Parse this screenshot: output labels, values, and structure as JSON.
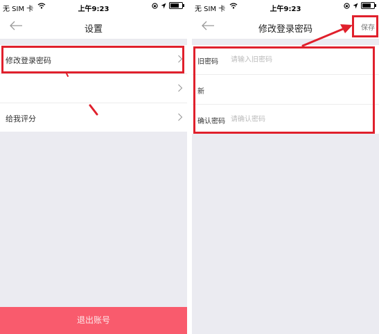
{
  "status_bar": {
    "carrier": "无 SIM 卡",
    "time": "上午9:23"
  },
  "settings_screen": {
    "title": "设置",
    "items": [
      {
        "label": "修改登录密码"
      },
      {
        "label": ""
      },
      {
        "label": "给我评分"
      }
    ],
    "logout_label": "退出账号"
  },
  "change_password_screen": {
    "title": "修改登录密码",
    "save_label": "保存",
    "fields": [
      {
        "label": "旧密码",
        "placeholder": "请输入旧密码"
      },
      {
        "label": "新",
        "placeholder": ""
      },
      {
        "label": "确认密码",
        "placeholder": "请确认密码"
      }
    ]
  },
  "colors": {
    "accent_red": "#f95b6d",
    "annotation_red": "#e0202c",
    "background_gray": "#ebebf1"
  }
}
